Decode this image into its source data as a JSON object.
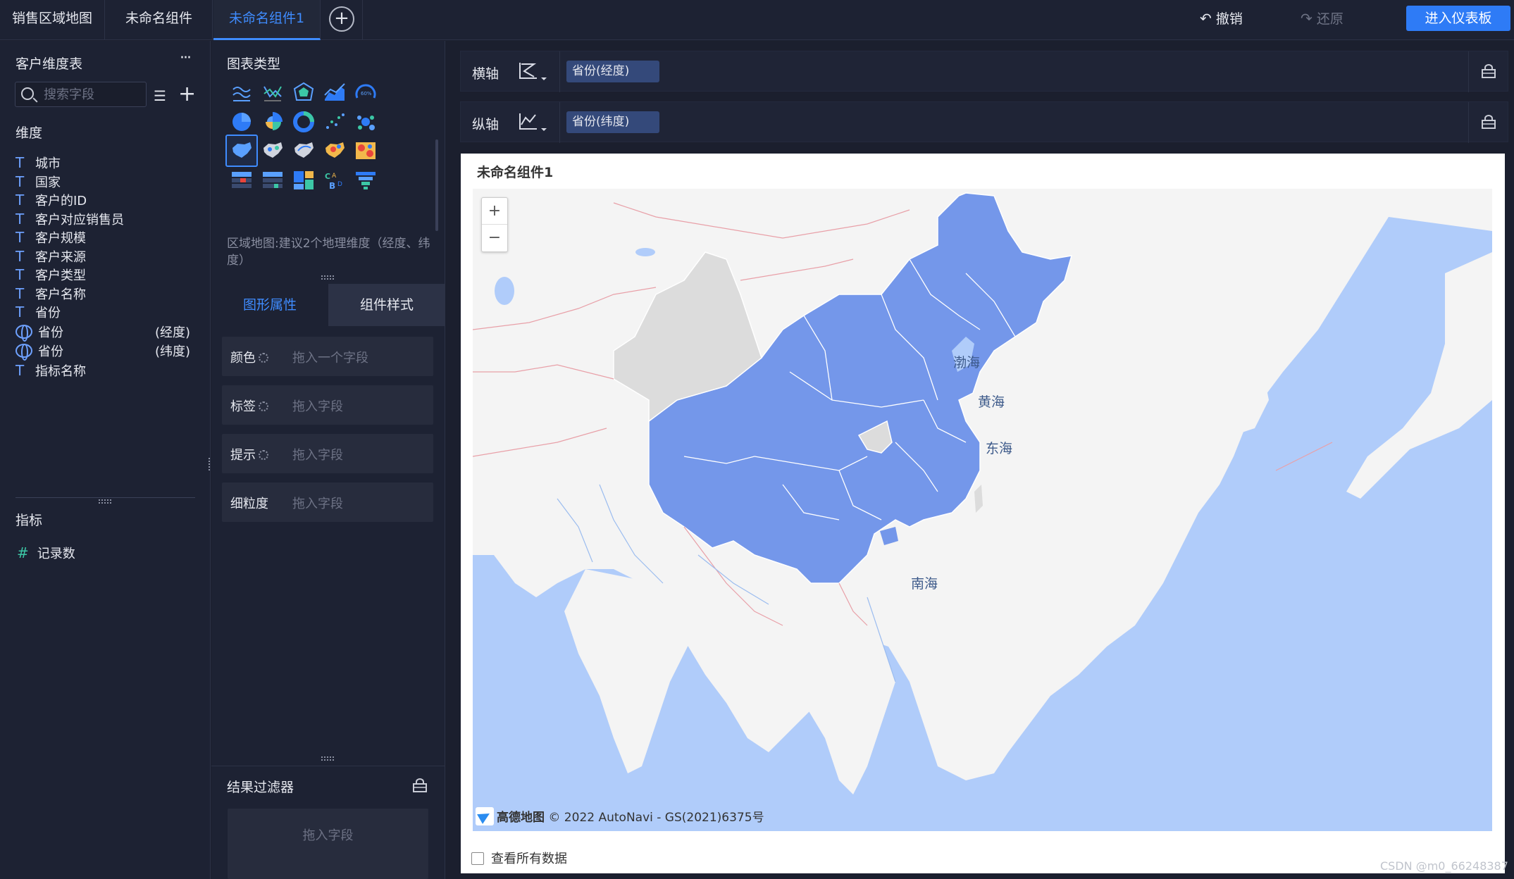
{
  "tabs": [
    {
      "label": "销售区域地图",
      "active": false
    },
    {
      "label": "未命名组件",
      "active": false
    },
    {
      "label": "未命名组件1",
      "active": true
    }
  ],
  "toolbar": {
    "undo": "撤销",
    "redo": "还原",
    "enter_dashboard": "进入仪表板"
  },
  "dataset": {
    "title": "客户维度表",
    "search_placeholder": "搜索字段",
    "dimension_header": "维度",
    "dimensions": [
      {
        "label": "城市",
        "type": "text"
      },
      {
        "label": "国家",
        "type": "text"
      },
      {
        "label": "客户的ID",
        "type": "text"
      },
      {
        "label": "客户对应销售员",
        "type": "text"
      },
      {
        "label": "客户规模",
        "type": "text"
      },
      {
        "label": "客户来源",
        "type": "text"
      },
      {
        "label": "客户类型",
        "type": "text"
      },
      {
        "label": "客户名称",
        "type": "text"
      },
      {
        "label": "省份",
        "type": "text"
      },
      {
        "label": "省份",
        "type": "geo",
        "suffix": "(经度)"
      },
      {
        "label": "省份",
        "type": "geo",
        "suffix": "(纬度)"
      },
      {
        "label": "指标名称",
        "type": "text"
      }
    ],
    "measure_header": "指标",
    "measures": [
      {
        "label": "记录数"
      }
    ]
  },
  "chart_types": {
    "title": "图表类型",
    "hint": "区域地图:建议2个地理维度（经度、纬度）"
  },
  "props": {
    "tab_shape": "图形属性",
    "tab_style": "组件样式",
    "rows": [
      {
        "label": "颜色",
        "placeholder": "拖入一个字段",
        "gear": true
      },
      {
        "label": "标签",
        "placeholder": "拖入字段",
        "gear": true
      },
      {
        "label": "提示",
        "placeholder": "拖入字段",
        "gear": true
      },
      {
        "label": "细粒度",
        "placeholder": "拖入字段",
        "gear": false
      }
    ]
  },
  "filter": {
    "title": "结果过滤器",
    "placeholder": "拖入字段"
  },
  "axes": {
    "x_label": "横轴",
    "x_field": "省份(经度)",
    "y_label": "纵轴",
    "y_field": "省份(纬度)"
  },
  "card": {
    "title": "未命名组件1",
    "view_all": "查看所有数据"
  },
  "map": {
    "zoom_in": "+",
    "zoom_out": "−",
    "attribution_brand": "高德地图",
    "attribution": "© 2022 AutoNavi - GS(2021)6375号",
    "seas": [
      "渤海",
      "黄海",
      "东海",
      "南海"
    ],
    "fill_color": "#7497ea",
    "nodata_color": "#dcdcdc",
    "water_color": "#b0ccfa",
    "land_color": "#f4f4f4"
  },
  "watermark": "CSDN @m0_66248387"
}
